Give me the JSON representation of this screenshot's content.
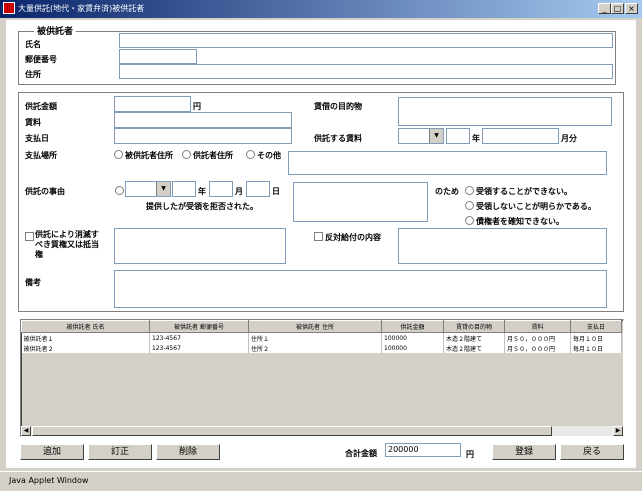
{
  "window": {
    "title": "大量供託(地代・家賃弁済)被供託者"
  },
  "section1": {
    "legend": "被供託者",
    "name_label": "氏名",
    "postal_label": "郵便番号",
    "address_label": "住所"
  },
  "section2": {
    "amount_label": "供託金額",
    "yen": "円",
    "rent_label": "賃料",
    "payday_label": "支払日",
    "purpose_label": "賃借の目的物",
    "target_rent_label": "供託する賃料",
    "year": "年",
    "month_portion": "月分",
    "place_label": "支払場所",
    "place_opt1": "被供託者住所",
    "place_opt2": "供託者住所",
    "place_opt3": "その他",
    "reason_label": "供託の事由",
    "month": "月",
    "day": "日",
    "refused_text": "提供したが受領を拒否された。",
    "reason_for": "のため",
    "reason_opt1": "受領することができない。",
    "reason_opt2": "受領しないことが明らかである。",
    "reason_opt3": "債権者を確知できない。",
    "extinct_label": "供託により消滅すべき質権又は抵当権",
    "counter_label": "反対給付の内容",
    "remarks_label": "備考"
  },
  "table": {
    "columns": [
      "被供託者 氏名",
      "被供託者 郵便番号",
      "被供託者 住所",
      "供託金額",
      "賃貸の目的物",
      "賃料",
      "支払日"
    ],
    "rows": [
      [
        "被供託者１",
        "123-4567",
        "住所１",
        "100000",
        "木造２階建て",
        "月５０，０００円",
        "毎月１０日"
      ],
      [
        "被供託者２",
        "123-4567",
        "住所２",
        "100000",
        "木造２階建て",
        "月５０，０００円",
        "毎月１０日"
      ]
    ]
  },
  "footer": {
    "add": "追加",
    "edit": "訂正",
    "delete": "削除",
    "total_label": "合計金額",
    "total_value": "200000",
    "yen": "円",
    "register": "登録",
    "back": "戻る"
  },
  "status": {
    "text": "Java Applet Window"
  }
}
